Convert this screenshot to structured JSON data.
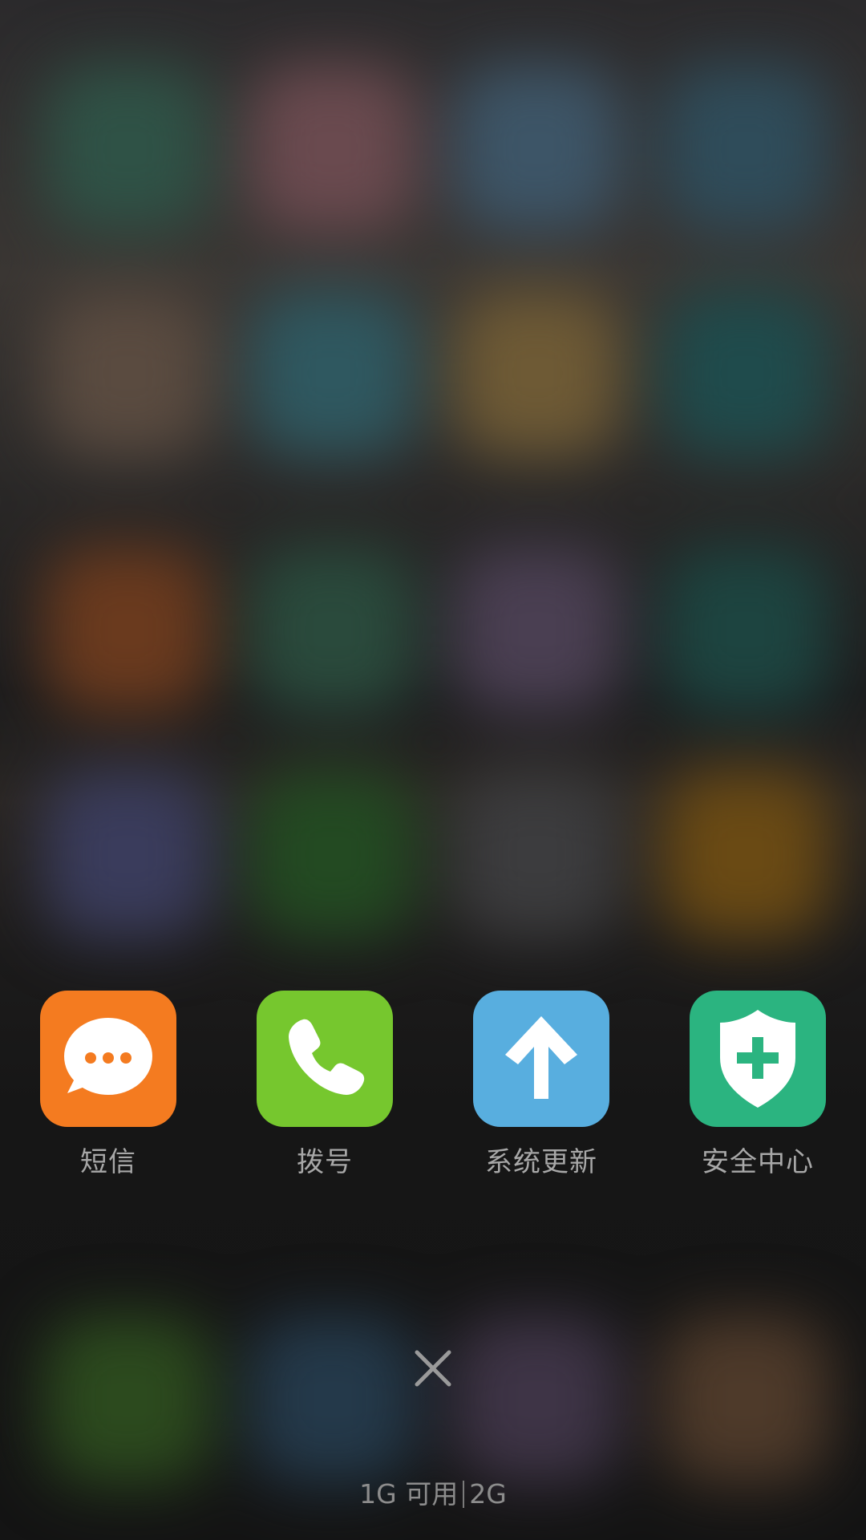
{
  "recent_apps": [
    {
      "label": "短信",
      "icon": "message-bubble-icon",
      "color": "#F47B20"
    },
    {
      "label": "拨号",
      "icon": "phone-handset-icon",
      "color": "#76C72E"
    },
    {
      "label": "系统更新",
      "icon": "arrow-up-icon",
      "color": "#58AEDF"
    },
    {
      "label": "安全中心",
      "icon": "shield-plus-icon",
      "color": "#2BB480"
    }
  ],
  "close_button": {
    "icon": "close-icon"
  },
  "memory": {
    "available": "1G 可用",
    "total": "2G"
  }
}
